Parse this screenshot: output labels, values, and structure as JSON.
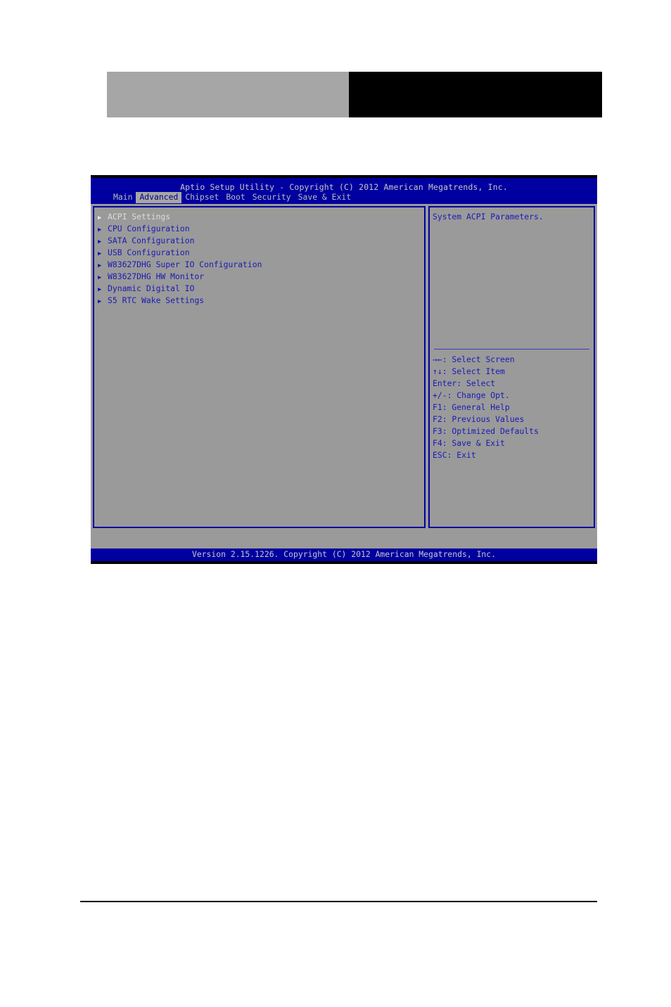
{
  "banner": {
    "left_block_label": "grey-block",
    "right_block_label": "black-block"
  },
  "bios": {
    "title": "Aptio Setup Utility - Copyright (C) 2012 American Megatrends, Inc.",
    "tabs": [
      {
        "label": "Main",
        "active": false
      },
      {
        "label": "Advanced",
        "active": true
      },
      {
        "label": "Chipset",
        "active": false
      },
      {
        "label": "Boot",
        "active": false
      },
      {
        "label": "Security",
        "active": false
      },
      {
        "label": "Save & Exit",
        "active": false
      }
    ],
    "menu": {
      "bullet": "▶",
      "items": [
        {
          "label": "ACPI Settings",
          "selected": true
        },
        {
          "label": "CPU Configuration",
          "selected": false
        },
        {
          "label": "SATA Configuration",
          "selected": false
        },
        {
          "label": "USB Configuration",
          "selected": false
        },
        {
          "label": "W83627DHG Super IO Configuration",
          "selected": false
        },
        {
          "label": "W83627DHG HW Monitor",
          "selected": false
        },
        {
          "label": "Dynamic Digital IO",
          "selected": false
        },
        {
          "label": "S5 RTC Wake Settings",
          "selected": false
        }
      ]
    },
    "help": {
      "description": "System ACPI Parameters."
    },
    "keys": [
      {
        "key": "→←",
        "action": ": Select Screen"
      },
      {
        "key": "↑↓",
        "action": ": Select Item"
      },
      {
        "key": "Enter",
        "action": ": Select"
      },
      {
        "key": "+/-",
        "action": ": Change Opt."
      },
      {
        "key": "F1",
        "action": ": General Help"
      },
      {
        "key": "F2",
        "action": ": Previous Values"
      },
      {
        "key": "F3",
        "action": ": Optimized Defaults"
      },
      {
        "key": "F4",
        "action": ": Save & Exit"
      },
      {
        "key": "ESC",
        "action": ": Exit"
      }
    ],
    "footer": "Version 2.15.1226. Copyright (C) 2012 American Megatrends, Inc."
  },
  "colors": {
    "header_blue": "#0000a0",
    "body_grey": "#9a9a9a",
    "text_blue": "#1a1ab4",
    "selected_text": "#dcdcdc",
    "header_text": "#c6c6c6"
  }
}
